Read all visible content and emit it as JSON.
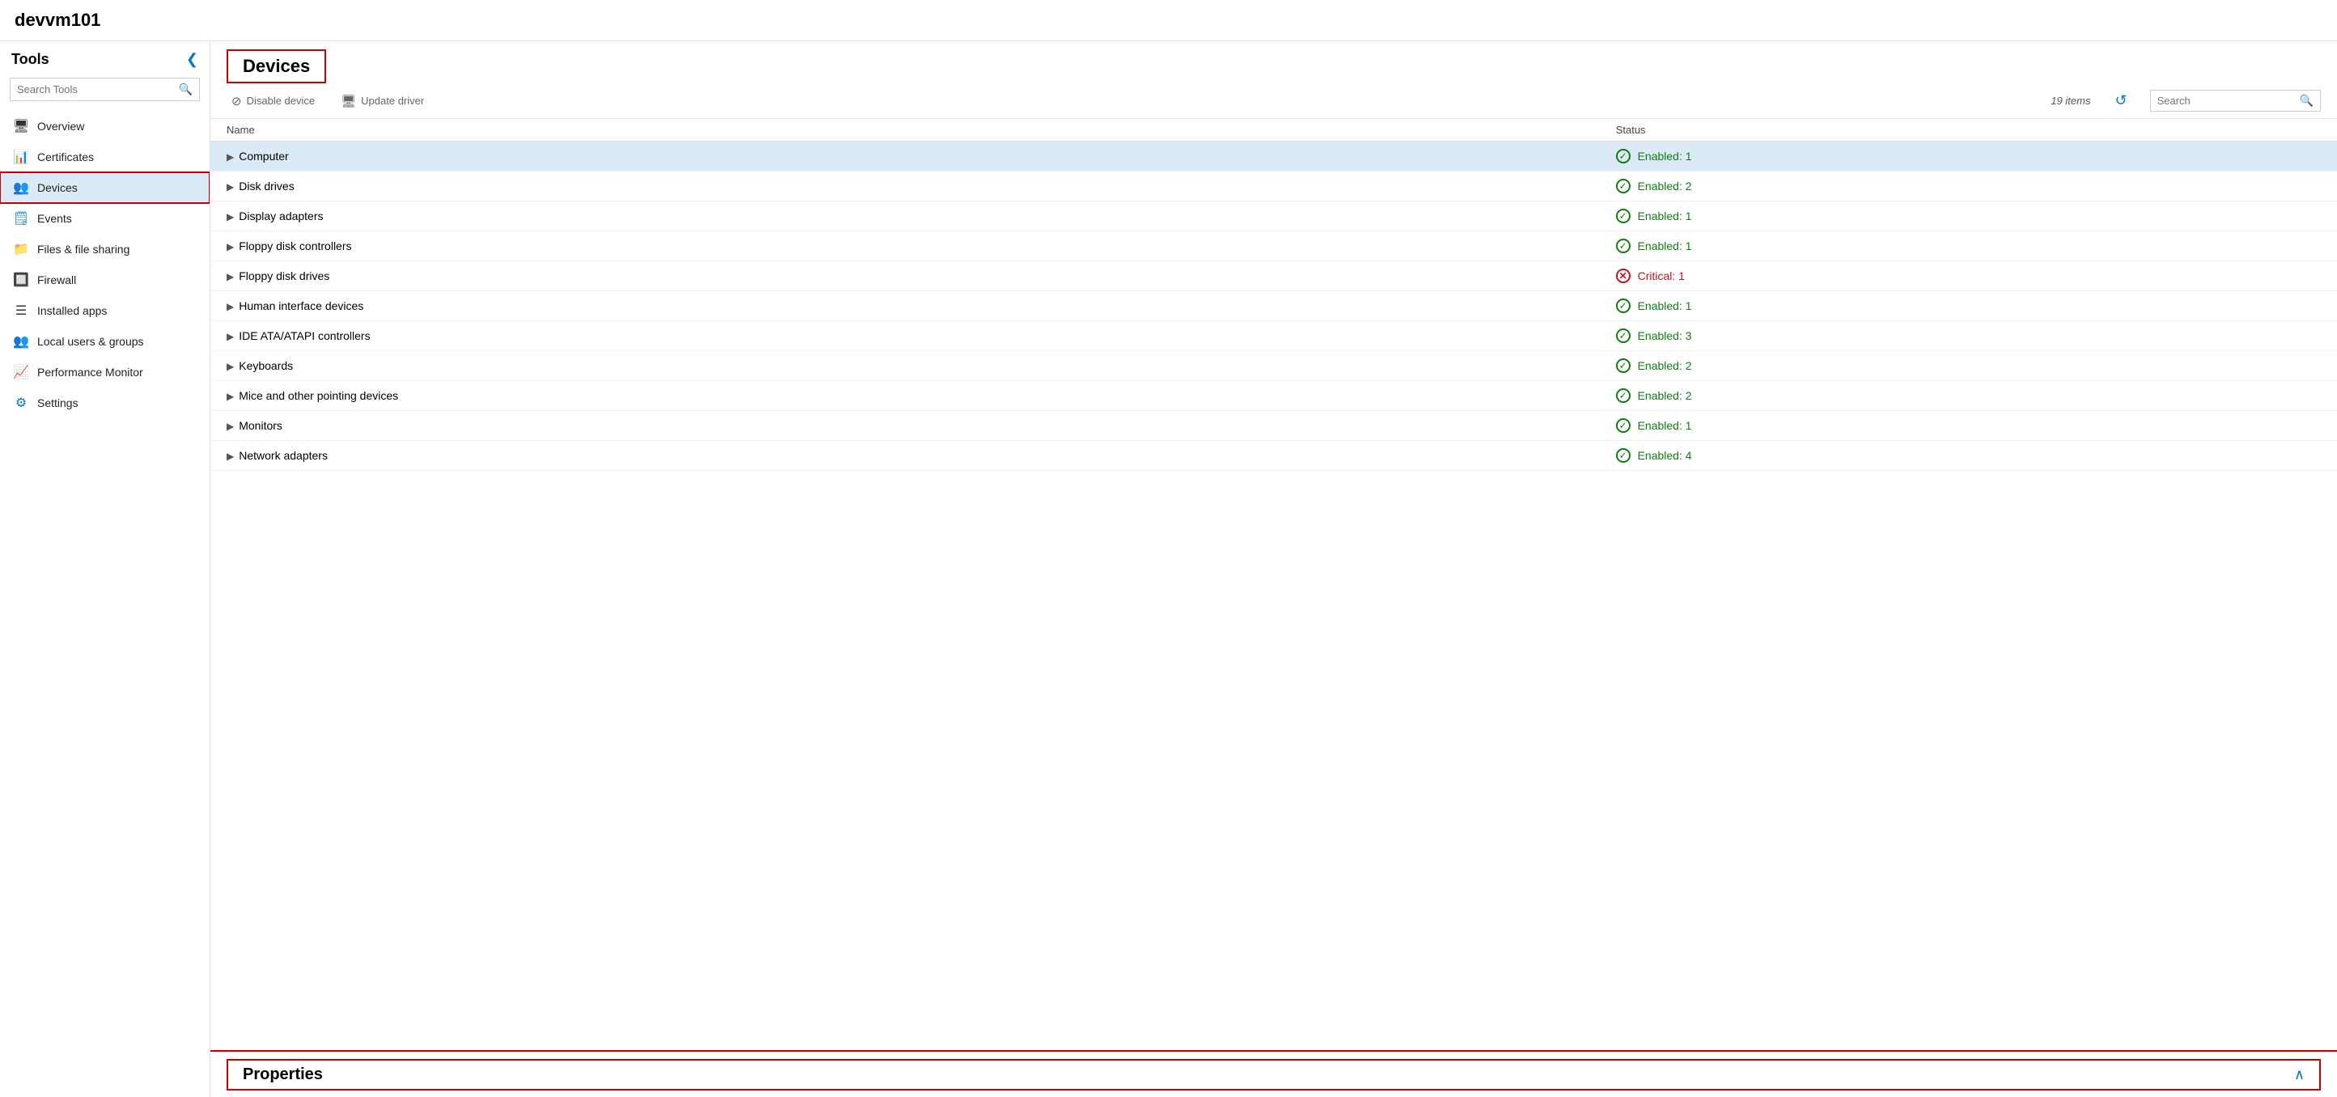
{
  "app": {
    "title": "devvm101"
  },
  "sidebar": {
    "title": "Tools",
    "search_placeholder": "Search Tools",
    "collapse_icon": "❮",
    "items": [
      {
        "id": "overview",
        "label": "Overview",
        "icon": "🖥",
        "active": false
      },
      {
        "id": "certificates",
        "label": "Certificates",
        "icon": "📊",
        "active": false
      },
      {
        "id": "devices",
        "label": "Devices",
        "icon": "👤",
        "active": true
      },
      {
        "id": "events",
        "label": "Events",
        "icon": "🗒",
        "active": false
      },
      {
        "id": "files-sharing",
        "label": "Files & file sharing",
        "icon": "📁",
        "active": false
      },
      {
        "id": "firewall",
        "label": "Firewall",
        "icon": "🔥",
        "active": false
      },
      {
        "id": "installed-apps",
        "label": "Installed apps",
        "icon": "☰",
        "active": false
      },
      {
        "id": "local-users",
        "label": "Local users & groups",
        "icon": "👥",
        "active": false
      },
      {
        "id": "performance",
        "label": "Performance Monitor",
        "icon": "📈",
        "active": false
      },
      {
        "id": "settings",
        "label": "Settings",
        "icon": "⚙",
        "active": false
      }
    ]
  },
  "devices_panel": {
    "title": "Devices",
    "toolbar": {
      "disable_device_label": "Disable device",
      "update_driver_label": "Update driver",
      "items_count": "19 items",
      "refresh_tooltip": "Refresh",
      "search_placeholder": "Search"
    },
    "table": {
      "columns": [
        "Name",
        "Status"
      ],
      "rows": [
        {
          "name": "Computer",
          "status": "Enabled: 1",
          "status_type": "enabled",
          "selected": true
        },
        {
          "name": "Disk drives",
          "status": "Enabled: 2",
          "status_type": "enabled",
          "selected": false
        },
        {
          "name": "Display adapters",
          "status": "Enabled: 1",
          "status_type": "enabled",
          "selected": false
        },
        {
          "name": "Floppy disk controllers",
          "status": "Enabled: 1",
          "status_type": "enabled",
          "selected": false
        },
        {
          "name": "Floppy disk drives",
          "status": "Critical: 1",
          "status_type": "critical",
          "selected": false
        },
        {
          "name": "Human interface devices",
          "status": "Enabled: 1",
          "status_type": "enabled",
          "selected": false
        },
        {
          "name": "IDE ATA/ATAPI controllers",
          "status": "Enabled: 3",
          "status_type": "enabled",
          "selected": false
        },
        {
          "name": "Keyboards",
          "status": "Enabled: 2",
          "status_type": "enabled",
          "selected": false
        },
        {
          "name": "Mice and other pointing devices",
          "status": "Enabled: 2",
          "status_type": "enabled",
          "selected": false
        },
        {
          "name": "Monitors",
          "status": "Enabled: 1",
          "status_type": "enabled",
          "selected": false
        },
        {
          "name": "Network adapters",
          "status": "Enabled: 4",
          "status_type": "enabled",
          "selected": false
        }
      ]
    }
  },
  "properties_panel": {
    "title": "Properties",
    "collapse_icon": "∧"
  }
}
